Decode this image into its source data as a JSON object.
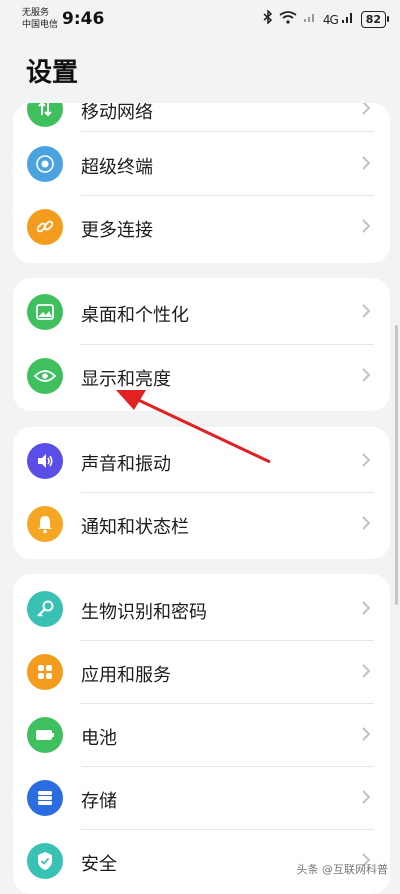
{
  "status": {
    "carrier_line1": "无服务",
    "carrier_line2": "中国电信",
    "time": "9:46",
    "signal_text": "4G",
    "battery": "82"
  },
  "title": "设置",
  "groups": [
    {
      "items": [
        {
          "label": "移动网络",
          "icon": "mobile-network-icon",
          "color": "#3fbf5e"
        },
        {
          "label": "超级终端",
          "icon": "super-device-icon",
          "color": "#4aa3df"
        },
        {
          "label": "更多连接",
          "icon": "link-icon",
          "color": "#f39c1e"
        }
      ]
    },
    {
      "items": [
        {
          "label": "桌面和个性化",
          "icon": "wallpaper-icon",
          "color": "#3fbf5e"
        },
        {
          "label": "显示和亮度",
          "icon": "eye-icon",
          "color": "#3fbf5e"
        }
      ]
    },
    {
      "items": [
        {
          "label": "声音和振动",
          "icon": "speaker-icon",
          "color": "#5b4ee8"
        },
        {
          "label": "通知和状态栏",
          "icon": "bell-icon",
          "color": "#f5a623"
        }
      ]
    },
    {
      "items": [
        {
          "label": "生物识别和密码",
          "icon": "key-icon",
          "color": "#39c2b4"
        },
        {
          "label": "应用和服务",
          "icon": "apps-icon",
          "color": "#f39c1e"
        },
        {
          "label": "电池",
          "icon": "battery-icon",
          "color": "#3fbf5e"
        },
        {
          "label": "存储",
          "icon": "storage-icon",
          "color": "#2b6de0"
        },
        {
          "label": "安全",
          "icon": "shield-icon",
          "color": "#39c2b4"
        }
      ]
    }
  ],
  "watermark": "头条 @互联网科普"
}
